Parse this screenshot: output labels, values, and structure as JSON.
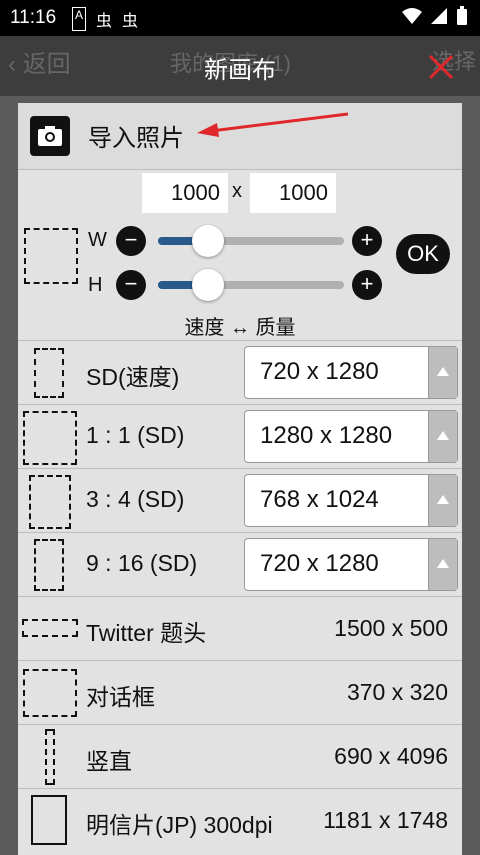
{
  "status": {
    "time": "11:16",
    "left_icons": [
      "A",
      "虫",
      "虫"
    ]
  },
  "appbar": {
    "back": "返回",
    "title": "我的图库 (1)",
    "select": "选择"
  },
  "dialog": {
    "title": "新画布"
  },
  "import": {
    "label": "导入照片"
  },
  "size": {
    "width": "1000",
    "times": "x",
    "height": "1000",
    "w_label": "W",
    "h_label": "H",
    "minus": "−",
    "plus": "+",
    "ok": "OK",
    "speed_quality": "速度 ↔ 质量"
  },
  "presets": [
    {
      "label": "SD(速度)",
      "value": "720 x 1280",
      "type": "select"
    },
    {
      "label": "1 : 1 (SD)",
      "value": "1280 x 1280",
      "type": "select"
    },
    {
      "label": "3 : 4 (SD)",
      "value": "768 x 1024",
      "type": "select"
    },
    {
      "label": "9 : 16 (SD)",
      "value": "720 x 1280",
      "type": "select"
    },
    {
      "label": "Twitter 题头",
      "value": "1500 x 500",
      "type": "text"
    },
    {
      "label": "对话框",
      "value": "370 x 320",
      "type": "text"
    },
    {
      "label": "竖直",
      "value": "690 x 4096",
      "type": "text"
    },
    {
      "label": "明信片(JP) 300dpi",
      "value": "1181 x 1748",
      "type": "text"
    }
  ],
  "colors": {
    "accent_close": "#e0282b",
    "slider_fill": "#2a5a8a"
  }
}
